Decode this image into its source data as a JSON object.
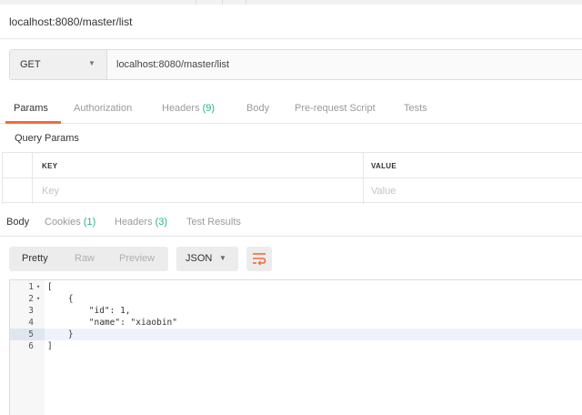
{
  "window": {
    "title": "localhost:8080/master/list"
  },
  "request": {
    "method": "GET",
    "url": "localhost:8080/master/list"
  },
  "request_tabs": [
    {
      "label": "Params",
      "count": ""
    },
    {
      "label": "Authorization",
      "count": ""
    },
    {
      "label": "Headers",
      "count": "(9)"
    },
    {
      "label": "Body",
      "count": ""
    },
    {
      "label": "Pre-request Script",
      "count": ""
    },
    {
      "label": "Tests",
      "count": ""
    }
  ],
  "query_params": {
    "title": "Query Params",
    "columns": [
      "KEY",
      "VALUE"
    ],
    "placeholders": {
      "key": "Key",
      "value": "Value"
    }
  },
  "response_tabs": [
    {
      "label": "Body",
      "count": ""
    },
    {
      "label": "Cookies",
      "count": "(1)"
    },
    {
      "label": "Headers",
      "count": "(3)"
    },
    {
      "label": "Test Results",
      "count": ""
    }
  ],
  "view_modes": [
    "Pretty",
    "Raw",
    "Preview"
  ],
  "format": "JSON",
  "icons": {
    "wrap": "wrap-lines-icon",
    "method_caret": "chevron-down-icon",
    "format_caret": "chevron-down-icon"
  },
  "colors": {
    "accent": "#f26b3a",
    "count": "#26b47f"
  },
  "editor": {
    "line_numbers": [
      "1",
      "2",
      "3",
      "4",
      "5",
      "6"
    ],
    "fold_markers": [
      "▾",
      "▾",
      "",
      "",
      "",
      ""
    ],
    "lines": [
      "[",
      "    {",
      "        \"id\": 1,",
      "        \"name\": \"xiaobin\"",
      "    }",
      "]"
    ]
  }
}
